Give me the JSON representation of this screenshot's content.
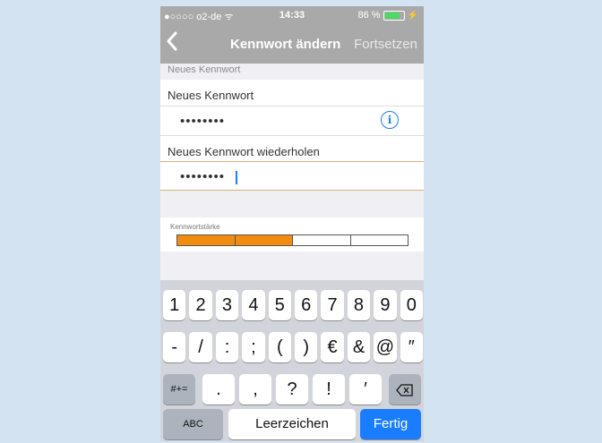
{
  "status_bar": {
    "carrier": "●○○○○ o2-de ᯤ",
    "time": "14:33",
    "battery_label": "86 %",
    "battery_level": 0.86
  },
  "nav": {
    "back_icon": "chevron-left",
    "title": "Kennwort ändern",
    "right_button": "Fortsetzen"
  },
  "form": {
    "section_label": "Neues Kennwort",
    "field1_label": "Neues Kennwort",
    "field1_value": "••••••••",
    "field2_label": "Neues Kennwort wiederholen",
    "field2_value": "••••••••"
  },
  "strength": {
    "label": "Kennwortstärke",
    "segments": 4,
    "filled": 2,
    "color": "#f28c0f"
  },
  "keyboard": {
    "row1": [
      "1",
      "2",
      "3",
      "4",
      "5",
      "6",
      "7",
      "8",
      "9",
      "0"
    ],
    "row2": [
      "-",
      "/",
      ":",
      ";",
      "(",
      ")",
      "€",
      "&",
      "@",
      "″"
    ],
    "row3": [
      ".",
      ",",
      "?",
      "!",
      "′"
    ],
    "shift_label": "#+=",
    "abc_label": "ABC",
    "space_label": "Leerzeichen",
    "done_label": "Fertig"
  },
  "colors": {
    "accent": "#1a7dff",
    "nav_bg": "#a9a9a9",
    "strength": "#f28c0f"
  }
}
